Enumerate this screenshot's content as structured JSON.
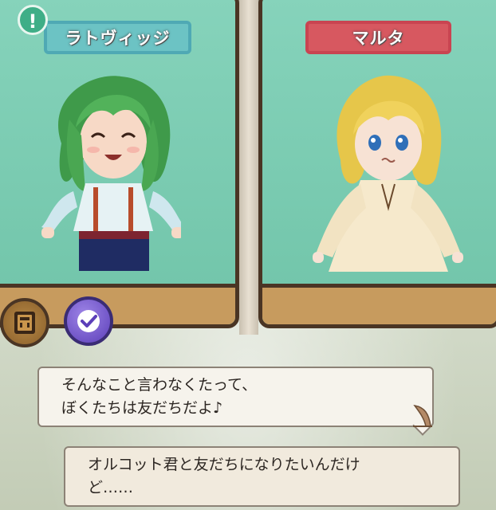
{
  "characters": {
    "left": {
      "name": "ラトヴィッジ",
      "nameplate_color": "#6cc3c4"
    },
    "right": {
      "name": "マルタ",
      "nameplate_color": "#d75860"
    }
  },
  "alert": {
    "glyph": "!"
  },
  "buttons": {
    "log": {
      "icon": "book-icon"
    },
    "auto": {
      "icon": "check-icon"
    }
  },
  "dialogue": {
    "upper": {
      "lines": [
        "そんなこと言わなくたって、",
        "ぼくたちは友だちだよ♪"
      ]
    },
    "lower": {
      "lines": [
        "オルコット君と友だちになりたいんだけ",
        "ど……"
      ]
    }
  }
}
